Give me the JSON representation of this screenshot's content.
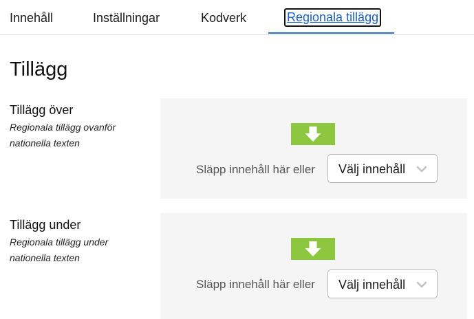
{
  "tabs": [
    {
      "label": "Innehåll"
    },
    {
      "label": "Inställningar"
    },
    {
      "label": "Kodverk"
    },
    {
      "label": "Regionala tillägg"
    }
  ],
  "active_tab": "Regionala tillägg",
  "page": {
    "title": "Tillägg"
  },
  "sections": [
    {
      "label": "Tillägg över",
      "description": "Regionala tillägg ovanför nationella texten",
      "drop_text": "Släpp innehåll här eller",
      "button_label": "Välj innehåll"
    },
    {
      "label": "Tillägg under",
      "description": "Regionala tillägg under nationella texten",
      "drop_text": "Släpp innehåll här eller",
      "button_label": "Välj innehåll"
    }
  ],
  "colors": {
    "accent": "#2a6fd6",
    "drop_icon": "#8dc63f",
    "dropzone_bg": "#f5f5f5"
  },
  "icons": {
    "drop": "arrow-down-icon",
    "select": "chevron-down-icon"
  }
}
